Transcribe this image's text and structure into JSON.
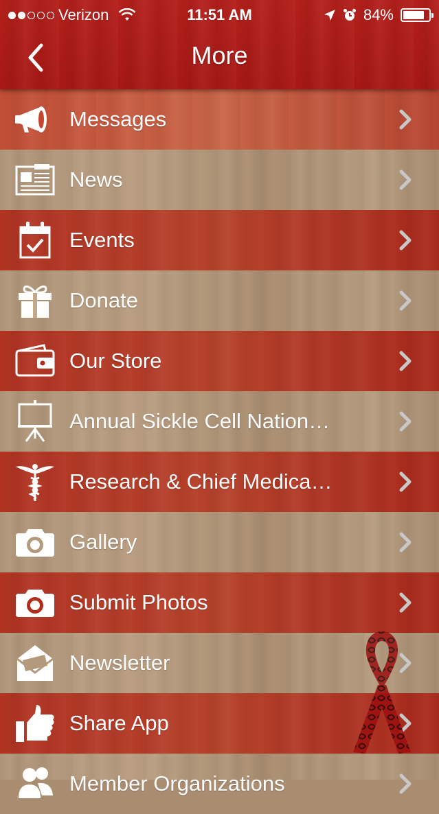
{
  "status_bar": {
    "carrier": "Verizon",
    "time": "11:51 AM",
    "battery": "84%",
    "battery_level": 0.84,
    "signal_bars": 2
  },
  "navbar": {
    "title": "More",
    "back_icon": "chevron-left-icon"
  },
  "menu": [
    {
      "label": "Messages",
      "icon": "megaphone-icon"
    },
    {
      "label": "News",
      "icon": "newspaper-icon"
    },
    {
      "label": "Events",
      "icon": "calendar-check-icon"
    },
    {
      "label": "Donate",
      "icon": "gift-icon"
    },
    {
      "label": "Our Store",
      "icon": "wallet-icon"
    },
    {
      "label": "Annual Sickle Cell Nation…",
      "icon": "presentation-easel-icon"
    },
    {
      "label": "Research & Chief Medica…",
      "icon": "caduceus-icon"
    },
    {
      "label": "Gallery",
      "icon": "camera-icon"
    },
    {
      "label": "Submit Photos",
      "icon": "camera-icon"
    },
    {
      "label": "Newsletter",
      "icon": "open-envelope-icon"
    },
    {
      "label": "Share App",
      "icon": "thumbs-up-icon"
    },
    {
      "label": "Member Organizations",
      "icon": "people-icon"
    }
  ],
  "colors": {
    "header_red": "#b01e19",
    "row_red": "#b22c1c",
    "wood_tan": "#ad9276",
    "text": "#ffffff",
    "chevron": "#c8c8c8"
  }
}
